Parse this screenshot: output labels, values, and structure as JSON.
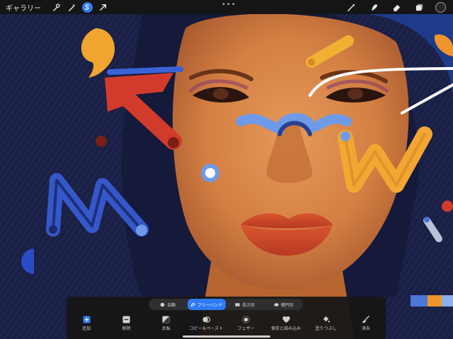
{
  "topbar": {
    "gallery_label": "ギャラリー",
    "left_tools": [
      {
        "name": "adjust-wrench-icon"
      },
      {
        "name": "magic-wand-icon"
      },
      {
        "name": "selection-s-icon",
        "active": true
      },
      {
        "name": "transform-arrow-icon"
      }
    ],
    "right_tools": [
      {
        "name": "brush-icon"
      },
      {
        "name": "smudge-icon"
      },
      {
        "name": "eraser-icon"
      },
      {
        "name": "layers-icon"
      },
      {
        "name": "color-picker-icon"
      }
    ],
    "more_glyph": "•••"
  },
  "selection_panel": {
    "modes": [
      {
        "label": "自動",
        "icon": "auto-dot-icon",
        "active": false
      },
      {
        "label": "フリーハンド",
        "icon": "freehand-icon",
        "active": true
      },
      {
        "label": "長方形",
        "icon": "rectangle-icon",
        "active": false
      },
      {
        "label": "楕円形",
        "icon": "ellipse-icon",
        "active": false
      }
    ],
    "actions": [
      {
        "label": "追加",
        "icon": "add-plus-icon"
      },
      {
        "label": "削除",
        "icon": "remove-minus-icon"
      },
      {
        "label": "反転",
        "icon": "invert-icon"
      },
      {
        "label": "コピー＆ペースト",
        "icon": "copy-paste-icon"
      },
      {
        "label": "フェザー",
        "icon": "feather-icon"
      },
      {
        "label": "保存と読み込み",
        "icon": "save-heart-icon"
      },
      {
        "label": "塗りつぶし",
        "icon": "fill-bucket-icon"
      },
      {
        "label": "消去",
        "icon": "clear-brush-icon"
      }
    ]
  },
  "colors": {
    "accent": "#2f7bf6",
    "toolbar_bg": "#151515",
    "artwork_navy": "#1a1f45",
    "skin": "#d47f43",
    "lip": "#c84a2b",
    "shape_red": "#d23b2b",
    "shape_blue": "#3558c9",
    "shape_yellow": "#f0b032"
  }
}
